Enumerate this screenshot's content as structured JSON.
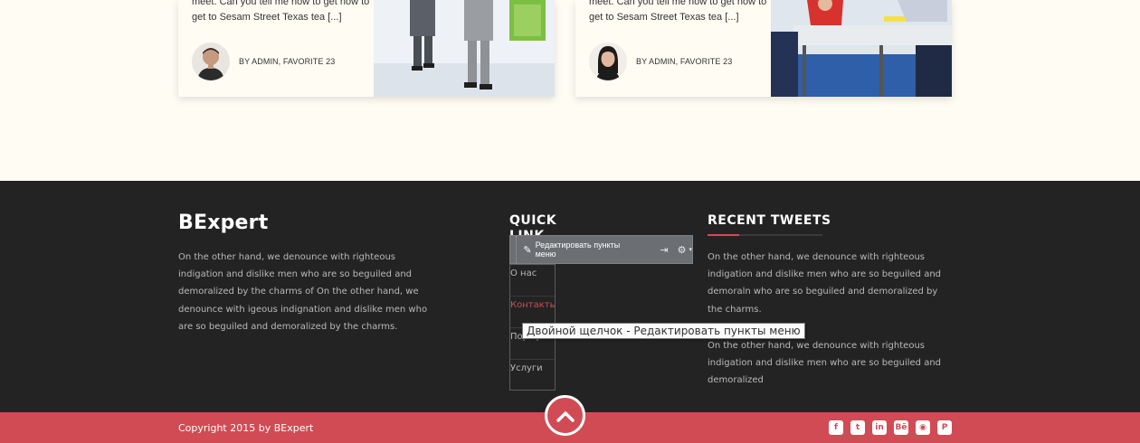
{
  "cards": [
    {
      "excerpt": "meet. Can you tell me how to get how to get to Sesam Street Texas tea [...]",
      "byline": "BY ADMIN, FAVORITE 23",
      "avatar_icon": "man-avatar",
      "photo": "business-people-walking-photo"
    },
    {
      "excerpt": "meet. Can you tell me how to get how to get to Sesam Street Texas tea [...]",
      "byline": "BY ADMIN, FAVORITE 23",
      "avatar_icon": "woman-avatar",
      "photo": "office-meeting-photo"
    }
  ],
  "footer": {
    "brand": "BExpert",
    "about": "On the other hand, we denounce with righteous indigation and dislike men who are so beguiled and demoralized by the charms of On the other hand, we denounce with igeous indignation and dislike men who are so beguiled and demoralized by the charms.",
    "quick_links": {
      "title": "QUICK LINK",
      "items": [
        {
          "label": "О нас",
          "active": false
        },
        {
          "label": "Контакты",
          "active": true
        },
        {
          "label": "Портфолио",
          "active": false
        },
        {
          "label": "Услуги",
          "active": false
        }
      ]
    },
    "edit_toolbar": {
      "label": "Редактировать пункты меню",
      "icons": [
        "pencil-icon",
        "move-icon",
        "gear-icon"
      ]
    },
    "tooltip": "Двойной щелчок - Редактировать пункты меню",
    "tweets": {
      "title": "RECENT TWEETS",
      "items": [
        "On the other hand, we denounce with righteous indigation and dislike men who are so beguiled and demoraln who are so beguiled and demoralized by the charms.",
        "On the other hand, we denounce with righteous indigation and dislike men who are so beguiled and demoralized"
      ]
    }
  },
  "bottom_bar": {
    "copyright": "Copyright 2015 by BExpert",
    "socials": [
      {
        "name": "facebook",
        "glyph": "f"
      },
      {
        "name": "twitter",
        "glyph": "t"
      },
      {
        "name": "linkedin",
        "glyph": "in"
      },
      {
        "name": "behance",
        "glyph": "Bē"
      },
      {
        "name": "rss",
        "glyph": "◉"
      },
      {
        "name": "pinterest",
        "glyph": "P"
      }
    ]
  },
  "colors": {
    "accent": "#d14b55",
    "footer_bg": "#232323",
    "page_bg": "#fefcf3",
    "text_muted": "#b9b9b9"
  }
}
